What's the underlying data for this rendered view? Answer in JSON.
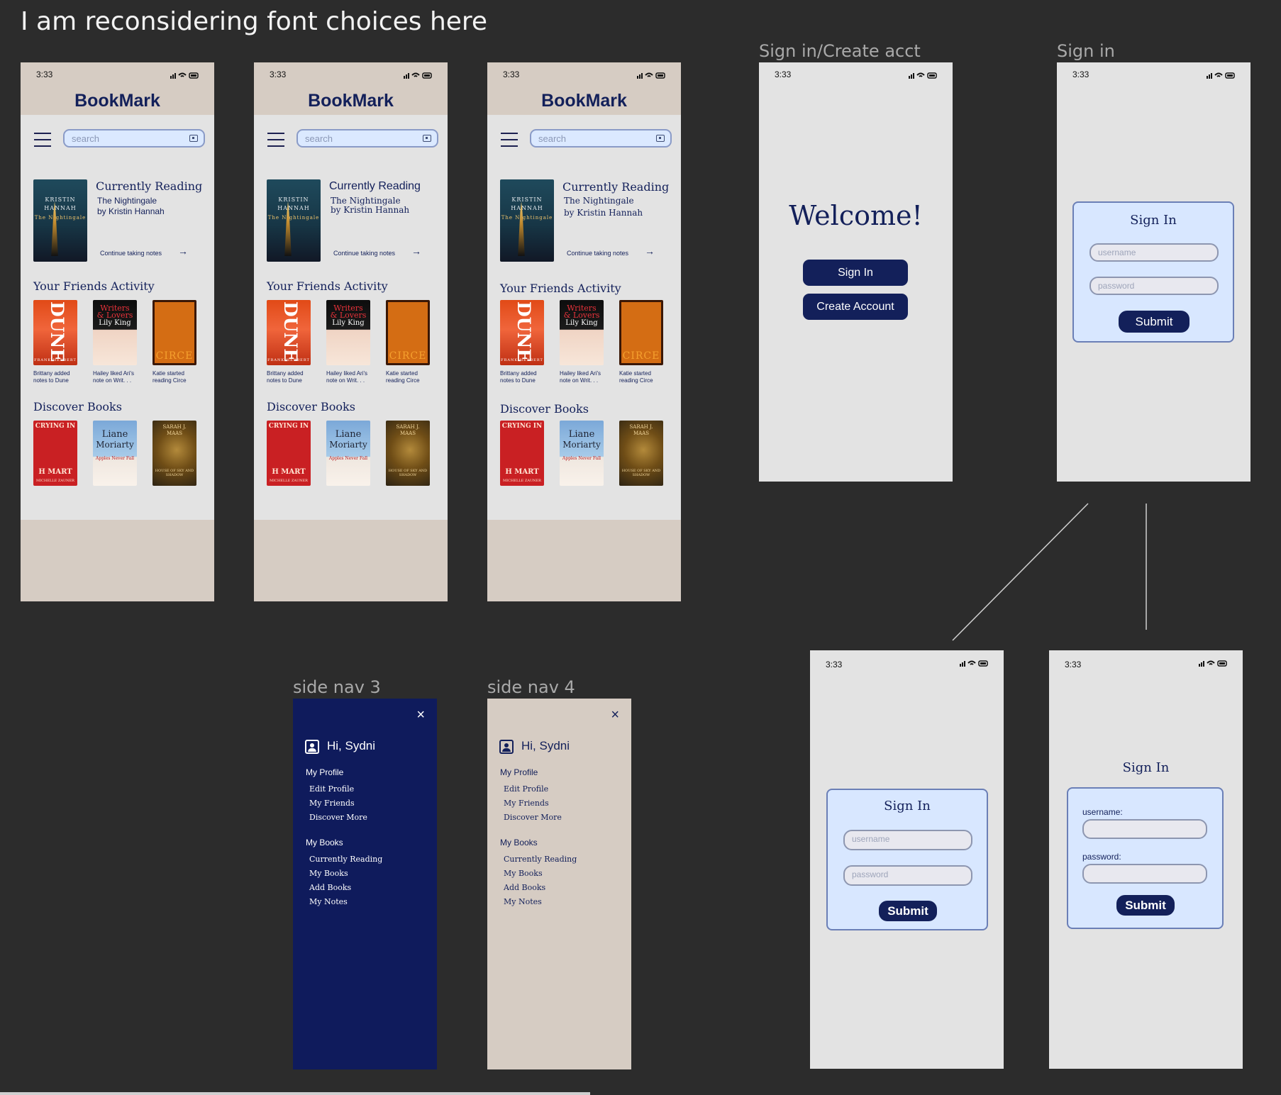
{
  "canvas": {
    "note": "I am reconsidering font choices here",
    "labels": {
      "signin_create": "Sign in/Create acct",
      "signin": "Sign in",
      "side_nav_3": "side nav 3",
      "side_nav_4": "side nav 4"
    }
  },
  "status_time": "3:33",
  "home": {
    "brand": "BookMark",
    "search_placeholder": "search",
    "currently_reading_title": "Currently Reading",
    "book_title": "The Nightingale",
    "book_author": "by Kristin Hannah",
    "continue_link": "Continue taking notes",
    "arrow": "→",
    "friends_title": "Your Friends Activity",
    "friends": [
      {
        "cover": "Dune",
        "caption_1": "Brittany added",
        "caption_2": "notes to Dune"
      },
      {
        "cover": "Writers & Lovers",
        "caption_1": "Hailey liked Ari's",
        "caption_2": "note on Writ. . ."
      },
      {
        "cover": "Circe",
        "caption_1": "Katie started",
        "caption_2": "reading Circe"
      }
    ],
    "discover_title": "Discover Books",
    "covers": {
      "nightingale_author": "KRISTIN",
      "nightingale_author_2": "HANNAH",
      "nightingale_title": "The Nightingale",
      "dune": "DUNE",
      "dune_author": "FRANK HERBERT",
      "writers": "Writers",
      "lovers": "& Lovers",
      "lily": "Lily King",
      "circe": "CIRCE",
      "hmart_top": "CRYING IN",
      "hmart_bottom": "H MART",
      "hmart_author": "MICHELLE ZAUNER",
      "moriarty_1": "Liane",
      "moriarty_2": "Moriarty",
      "moriarty_3": "Apples Never Fall",
      "maas_1": "SARAH J.",
      "maas_2": "MAAS",
      "maas_3": "HOUSE OF SKY AND SHADOW"
    }
  },
  "welcome": {
    "title": "Welcome!",
    "sign_in": "Sign In",
    "create_account": "Create Account"
  },
  "signin": {
    "title": "Sign In",
    "username_placeholder": "username",
    "password_placeholder": "password",
    "submit": "Submit",
    "username_label": "username:",
    "password_label": "password:"
  },
  "sidenav": {
    "close": "×",
    "greeting": "Hi, Sydni",
    "profile_group": "My Profile",
    "profile_items": [
      "Edit Profile",
      "My Friends",
      "Discover More"
    ],
    "books_group": "My Books",
    "books_items": [
      "Currently Reading",
      "My Books",
      "Add Books",
      "My Notes"
    ]
  },
  "colors": {
    "canvas": "#2c2c2c",
    "navy": "#13205a",
    "tan": "#d6ccc3",
    "light_blue": "#d8e7ff",
    "gray_screen": "#e3e3e3"
  },
  "icons": [
    "signal-icon",
    "wifi-icon",
    "battery-icon",
    "hamburger-icon",
    "search-scan-icon",
    "arrow-right-icon",
    "close-icon",
    "profile-icon"
  ]
}
